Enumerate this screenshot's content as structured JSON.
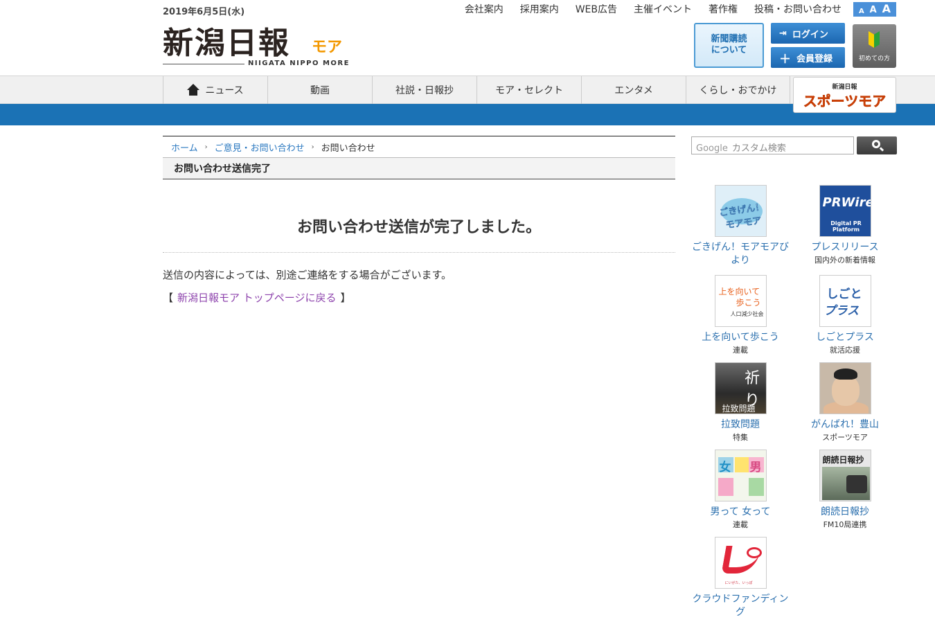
{
  "header": {
    "date": "2019年6月5日(水)",
    "logo_kanji": "新潟日報",
    "logo_more": "モア",
    "logo_sub": "NIIGATA NIPPO MORE",
    "top_links": [
      "会社案内",
      "採用案内",
      "WEB広告",
      "主催イベント",
      "著作権",
      "投稿・お問い合わせ"
    ],
    "font_size_labels": [
      "A",
      "A",
      "A"
    ],
    "subscribe_label": [
      "新聞購読",
      "について"
    ],
    "login_label": "ログイン",
    "register_label": "会員登録",
    "first_time_label": "初めての方"
  },
  "nav": {
    "items": [
      "ニュース",
      "動画",
      "社説・日報抄",
      "モア・セレクト",
      "エンタメ",
      "くらし・おでかけ"
    ],
    "sports_small": "新潟日報",
    "sports_big": "スポーツモア"
  },
  "breadcrumb": {
    "home": "ホーム",
    "parent": "ご意見・お問い合わせ",
    "current": "お問い合わせ"
  },
  "page": {
    "heading": "お問い合わせ送信完了",
    "done_title": "お問い合わせ送信が完了しました。",
    "done_body": "送信の内容によっては、別途ご連絡をする場合がございます。",
    "back_open": "【",
    "back_link": "新潟日報モア トップページに戻る",
    "back_close": "】"
  },
  "sidebar": {
    "search_brand": "Google",
    "search_placeholder": "カスタム検索",
    "banners": [
      {
        "title": "ごきげん！モアモアびより",
        "sub": "",
        "thumb_text": "ごきげん！モアモア"
      },
      {
        "title": "プレスリリース",
        "sub": "国内外の新着情報",
        "thumb_text": "PRWire",
        "thumb_sub": "Digital PR Platform"
      },
      {
        "title": "上を向いて歩こう",
        "sub": "連載",
        "thumb_text": "上を向いて",
        "thumb_text2": "歩こう",
        "thumb_sub": "人口減少社会"
      },
      {
        "title": "しごとプラス",
        "sub": "就活応援",
        "thumb_text": "しごと",
        "thumb_text2": "プラス"
      },
      {
        "title": "拉致問題",
        "sub": "特集",
        "thumb_text": "祈り",
        "thumb_sub": "拉致問題"
      },
      {
        "title": "がんばれ！豊山",
        "sub": "スポーツモア"
      },
      {
        "title": "男って 女って",
        "sub": "連載",
        "thumb_text": "女",
        "thumb_text2": "男"
      },
      {
        "title": "朗読日報抄",
        "sub": "FM10局連携",
        "thumb_text": "朗読日報抄"
      },
      {
        "title": "クラウドファンディング",
        "sub": "",
        "thumb_sub": "にいがた、いっぽ"
      }
    ]
  }
}
